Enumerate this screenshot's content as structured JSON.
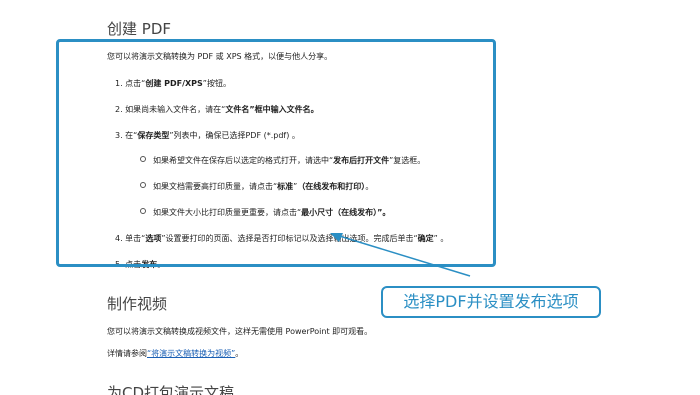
{
  "section1": {
    "title": "创建 PDF",
    "intro": "您可以将演示文稿转换为 PDF 或 XPS 格式，以便与他人分享。",
    "step1": {
      "pre": "1. 点击“",
      "bold": "创建 PDF/XPS",
      "post": "”按钮。"
    },
    "step2": {
      "pre": "2. 如果尚未输入文件名，请在“",
      "bold": "文件名",
      "mid": "”框中输入文件名。"
    },
    "step3": {
      "pre": "3. 在“",
      "bold": "保存类型",
      "post": "”列表中，确保已选择PDF (*.pdf) 。"
    },
    "sub1": {
      "pre": "如果希望文件在保存后以选定的格式打开，请选中“",
      "bold": "发布后打开文件",
      "post": "”复选框。"
    },
    "sub2": {
      "pre": "如果文档需要高打印质量，请点击“",
      "bold": "标准",
      "mid": "”",
      "bold2": "（在线发布和打印）",
      "post": "。"
    },
    "sub3": {
      "pre": "如果文件大小比打印质量更重要，请点击“",
      "bold": "最小尺寸",
      "post": "（在线发布）”。"
    },
    "step4": {
      "pre": "4. 单击“",
      "bold": "选项",
      "mid": "”设置要打印的页面、选择是否打印标记以及选择输出选项。完成后单击“",
      "bold2": "确定",
      "post": "” 。"
    },
    "step5": {
      "pre": "5. 点击",
      "bold": "发布",
      "post": "。"
    }
  },
  "section2": {
    "title": "制作视频",
    "para1": "您可以将演示文稿转换成视频文件，这样无需使用 PowerPoint 即可观看。",
    "para2_pre": "详情请参阅",
    "para2_link": "“将演示文稿转换为视频”",
    "para2_post": "。"
  },
  "section3": {
    "title": "为CD打包演示文稿"
  },
  "annotation": {
    "callout_text": "选择PDF并设置发布选项",
    "color": "#2b8fc4"
  }
}
